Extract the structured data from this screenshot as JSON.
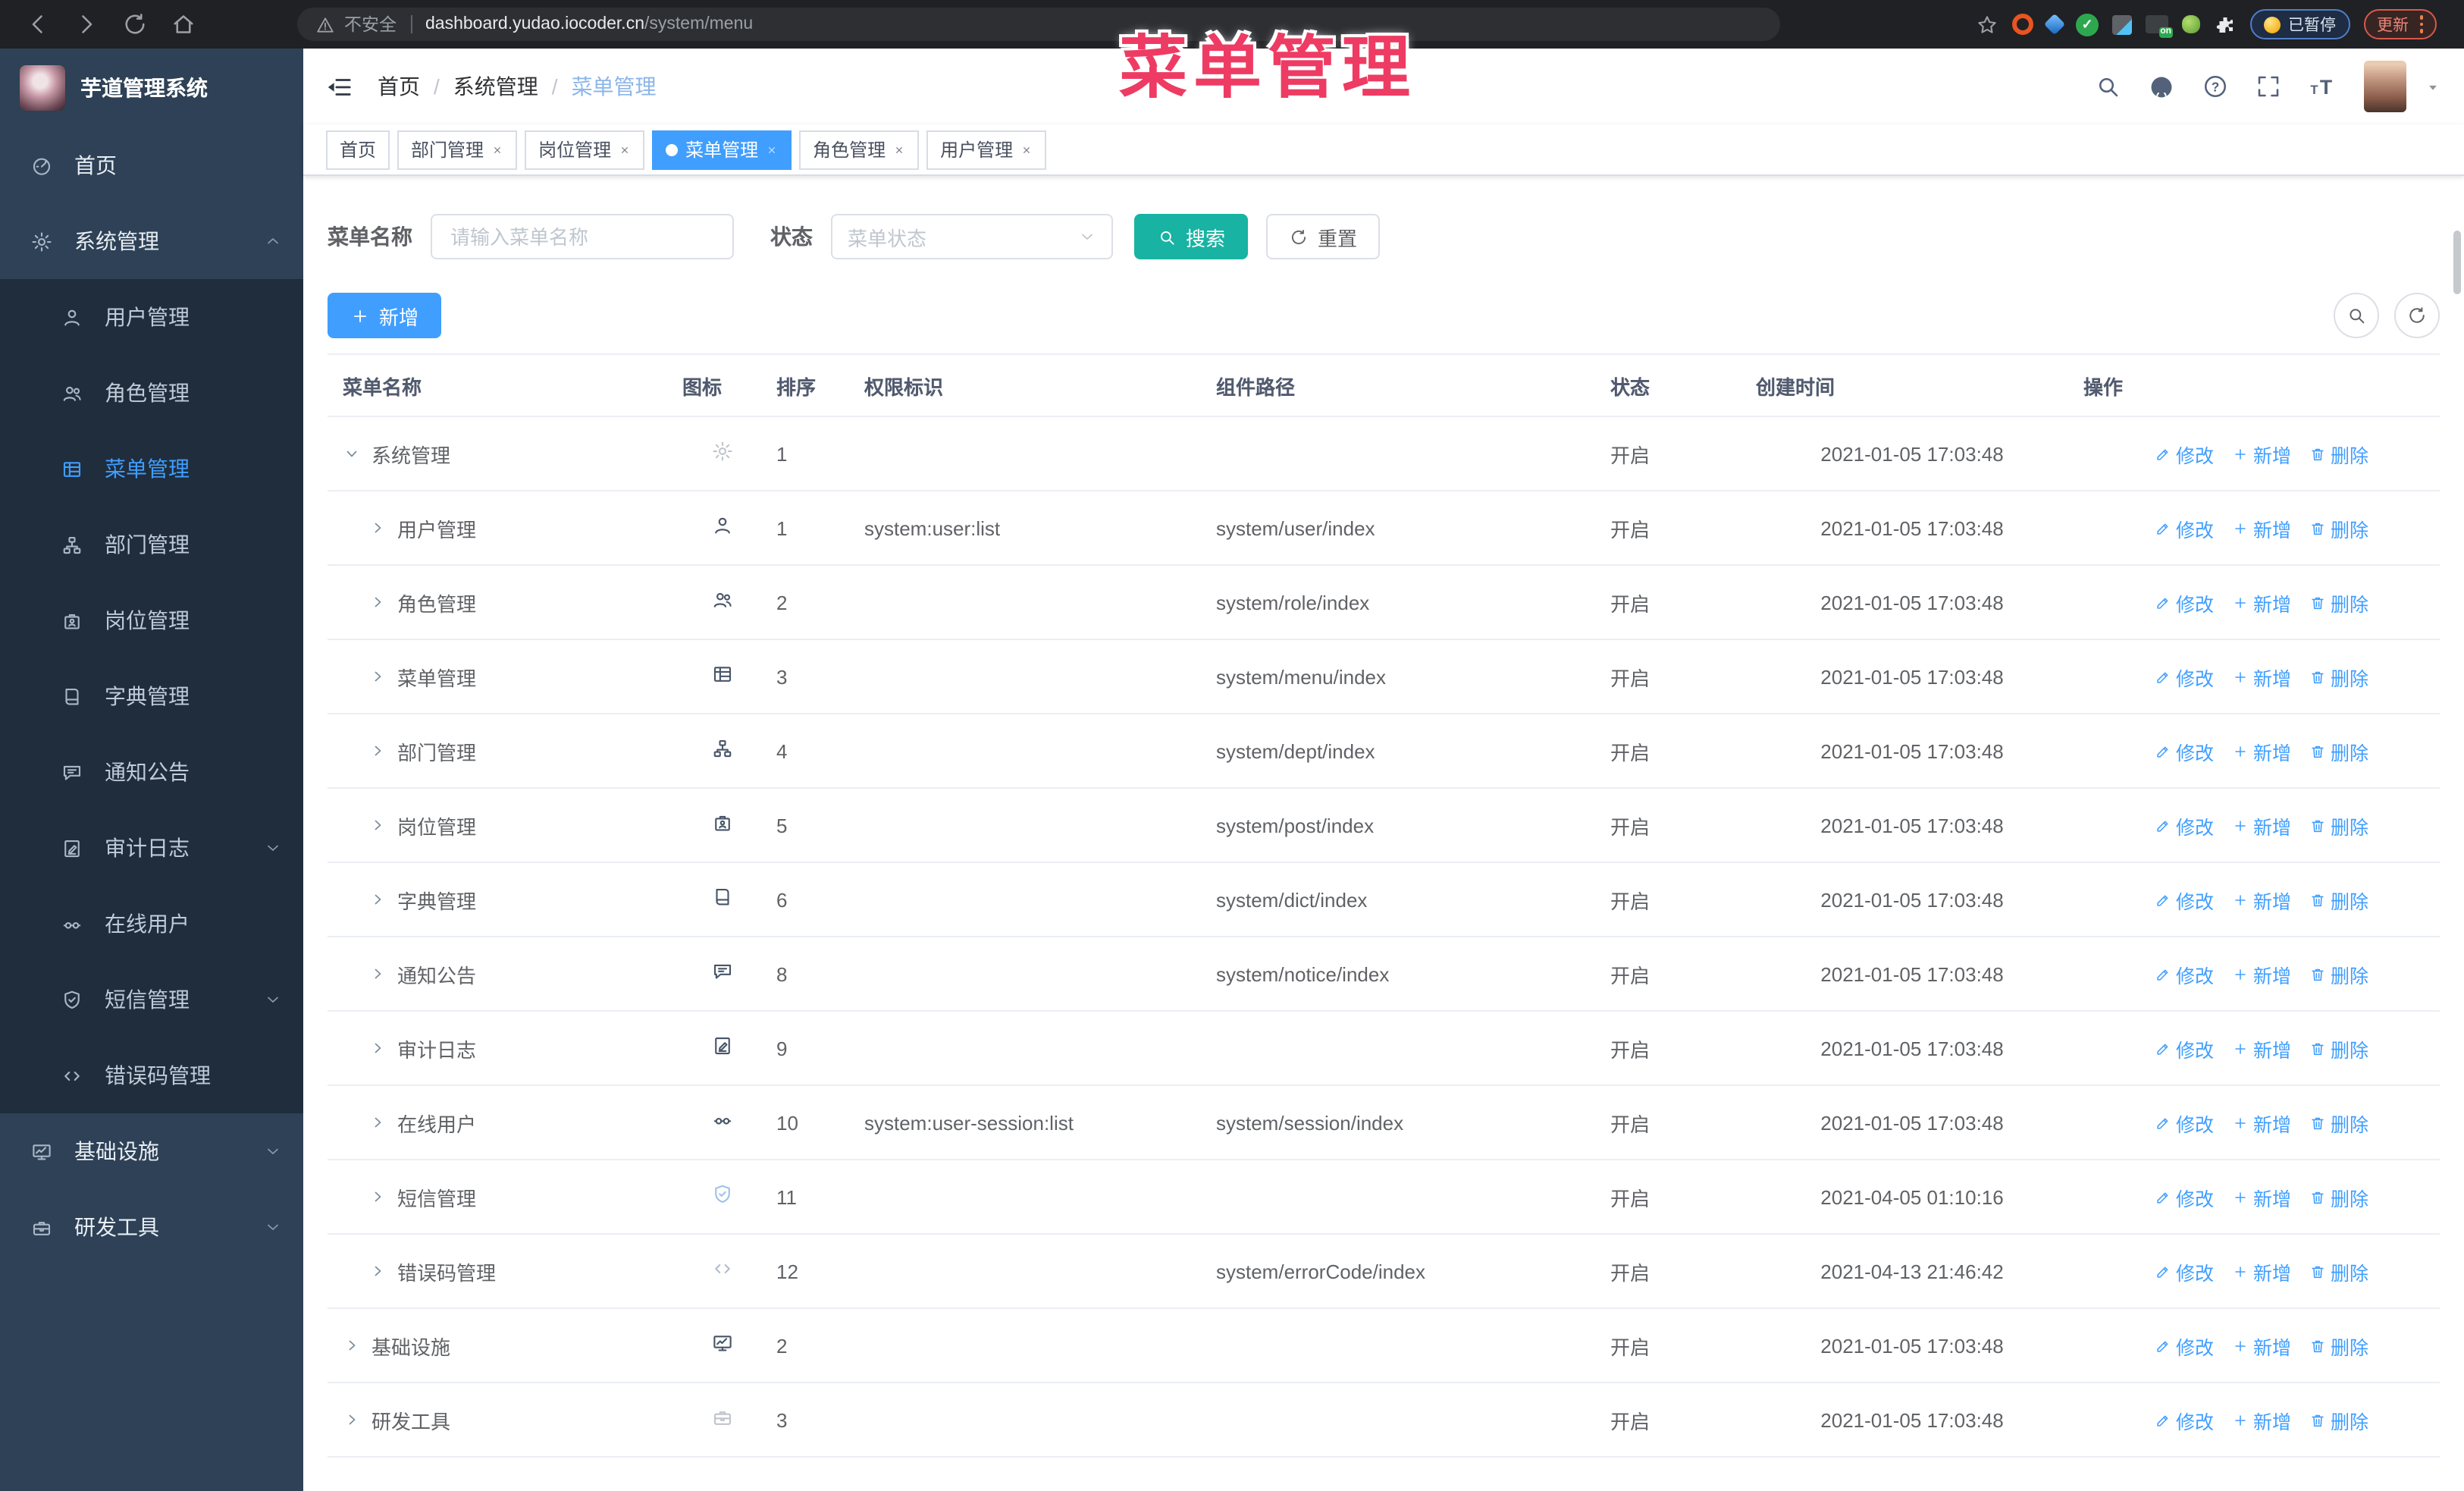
{
  "browser": {
    "insecure_label": "不安全",
    "url_host": "dashboard.yudao.iocoder.cn",
    "url_path": "/system/menu",
    "paused_label": "已暂停",
    "update_label": "更新"
  },
  "annotation": {
    "text": "菜单管理",
    "color": "#ee3b63"
  },
  "sidebar": {
    "title": "芋道管理系统",
    "items": [
      {
        "label": "首页",
        "icon": "gauge",
        "level": 1
      },
      {
        "label": "系统管理",
        "icon": "gear",
        "level": 1,
        "caret": "up"
      },
      {
        "label": "用户管理",
        "icon": "user",
        "level": 2
      },
      {
        "label": "角色管理",
        "icon": "users",
        "level": 2
      },
      {
        "label": "菜单管理",
        "icon": "menu",
        "level": 2,
        "active": true
      },
      {
        "label": "部门管理",
        "icon": "tree",
        "level": 2
      },
      {
        "label": "岗位管理",
        "icon": "post",
        "level": 2
      },
      {
        "label": "字典管理",
        "icon": "dict",
        "level": 2
      },
      {
        "label": "通知公告",
        "icon": "notice",
        "level": 2
      },
      {
        "label": "审计日志",
        "icon": "log",
        "level": 2,
        "caret": "down"
      },
      {
        "label": "在线用户",
        "icon": "online",
        "level": 2
      },
      {
        "label": "短信管理",
        "icon": "sms",
        "level": 2,
        "caret": "down"
      },
      {
        "label": "错误码管理",
        "icon": "code",
        "level": 2
      },
      {
        "label": "基础设施",
        "icon": "infra",
        "level": 1,
        "caret": "down"
      },
      {
        "label": "研发工具",
        "icon": "dev",
        "level": 1,
        "caret": "down"
      }
    ]
  },
  "navbar": {
    "breadcrumb": [
      "首页",
      "系统管理",
      "菜单管理"
    ]
  },
  "tabs": [
    {
      "label": "首页",
      "closable": false,
      "active": false
    },
    {
      "label": "部门管理",
      "closable": true,
      "active": false
    },
    {
      "label": "岗位管理",
      "closable": true,
      "active": false
    },
    {
      "label": "菜单管理",
      "closable": true,
      "active": true
    },
    {
      "label": "角色管理",
      "closable": true,
      "active": false
    },
    {
      "label": "用户管理",
      "closable": true,
      "active": false
    }
  ],
  "filters": {
    "name_label": "菜单名称",
    "name_placeholder": "请输入菜单名称",
    "status_label": "状态",
    "status_placeholder": "菜单状态",
    "search_label": "搜索",
    "reset_label": "重置"
  },
  "toolbar": {
    "add_label": "新增"
  },
  "table": {
    "headers": [
      "菜单名称",
      "图标",
      "排序",
      "权限标识",
      "组件路径",
      "状态",
      "创建时间",
      "操作"
    ],
    "action_labels": {
      "edit": "修改",
      "add": "新增",
      "delete": "删除"
    },
    "rows": [
      {
        "name": "系统管理",
        "icon": "gear",
        "icon_color": "#c0c4cc",
        "level": 1,
        "expanded": true,
        "sort": "1",
        "perm": "",
        "path": "",
        "status": "开启",
        "time": "2021-01-05 17:03:48"
      },
      {
        "name": "用户管理",
        "icon": "user",
        "icon_color": "#485568",
        "level": 2,
        "expanded": false,
        "sort": "1",
        "perm": "system:user:list",
        "path": "system/user/index",
        "status": "开启",
        "time": "2021-01-05 17:03:48"
      },
      {
        "name": "角色管理",
        "icon": "users",
        "icon_color": "#485568",
        "level": 2,
        "expanded": false,
        "sort": "2",
        "perm": "",
        "path": "system/role/index",
        "status": "开启",
        "time": "2021-01-05 17:03:48"
      },
      {
        "name": "菜单管理",
        "icon": "menu",
        "icon_color": "#485568",
        "level": 2,
        "expanded": false,
        "sort": "3",
        "perm": "",
        "path": "system/menu/index",
        "status": "开启",
        "time": "2021-01-05 17:03:48"
      },
      {
        "name": "部门管理",
        "icon": "tree",
        "icon_color": "#485568",
        "level": 2,
        "expanded": false,
        "sort": "4",
        "perm": "",
        "path": "system/dept/index",
        "status": "开启",
        "time": "2021-01-05 17:03:48"
      },
      {
        "name": "岗位管理",
        "icon": "post",
        "icon_color": "#485568",
        "level": 2,
        "expanded": false,
        "sort": "5",
        "perm": "",
        "path": "system/post/index",
        "status": "开启",
        "time": "2021-01-05 17:03:48"
      },
      {
        "name": "字典管理",
        "icon": "dict",
        "icon_color": "#485568",
        "level": 2,
        "expanded": false,
        "sort": "6",
        "perm": "",
        "path": "system/dict/index",
        "status": "开启",
        "time": "2021-01-05 17:03:48"
      },
      {
        "name": "通知公告",
        "icon": "notice",
        "icon_color": "#485568",
        "level": 2,
        "expanded": false,
        "sort": "8",
        "perm": "",
        "path": "system/notice/index",
        "status": "开启",
        "time": "2021-01-05 17:03:48"
      },
      {
        "name": "审计日志",
        "icon": "log",
        "icon_color": "#485568",
        "level": 2,
        "expanded": false,
        "sort": "9",
        "perm": "",
        "path": "",
        "status": "开启",
        "time": "2021-01-05 17:03:48"
      },
      {
        "name": "在线用户",
        "icon": "online",
        "icon_color": "#485568",
        "level": 2,
        "expanded": false,
        "sort": "10",
        "perm": "system:user-session:list",
        "path": "system/session/index",
        "status": "开启",
        "time": "2021-01-05 17:03:48"
      },
      {
        "name": "短信管理",
        "icon": "sms",
        "icon_color": "#9fc3e8",
        "level": 2,
        "expanded": false,
        "sort": "11",
        "perm": "",
        "path": "",
        "status": "开启",
        "time": "2021-04-05 01:10:16"
      },
      {
        "name": "错误码管理",
        "icon": "code",
        "icon_color": "#b4bccc",
        "level": 2,
        "expanded": false,
        "sort": "12",
        "perm": "",
        "path": "system/errorCode/index",
        "status": "开启",
        "time": "2021-04-13 21:46:42"
      },
      {
        "name": "基础设施",
        "icon": "infra",
        "icon_color": "#485568",
        "level": 1,
        "expanded": false,
        "sort": "2",
        "perm": "",
        "path": "",
        "status": "开启",
        "time": "2021-01-05 17:03:48"
      },
      {
        "name": "研发工具",
        "icon": "dev",
        "icon_color": "#c0c4cc",
        "level": 1,
        "expanded": false,
        "sort": "3",
        "perm": "",
        "path": "",
        "status": "开启",
        "time": "2021-01-05 17:03:48"
      }
    ]
  }
}
